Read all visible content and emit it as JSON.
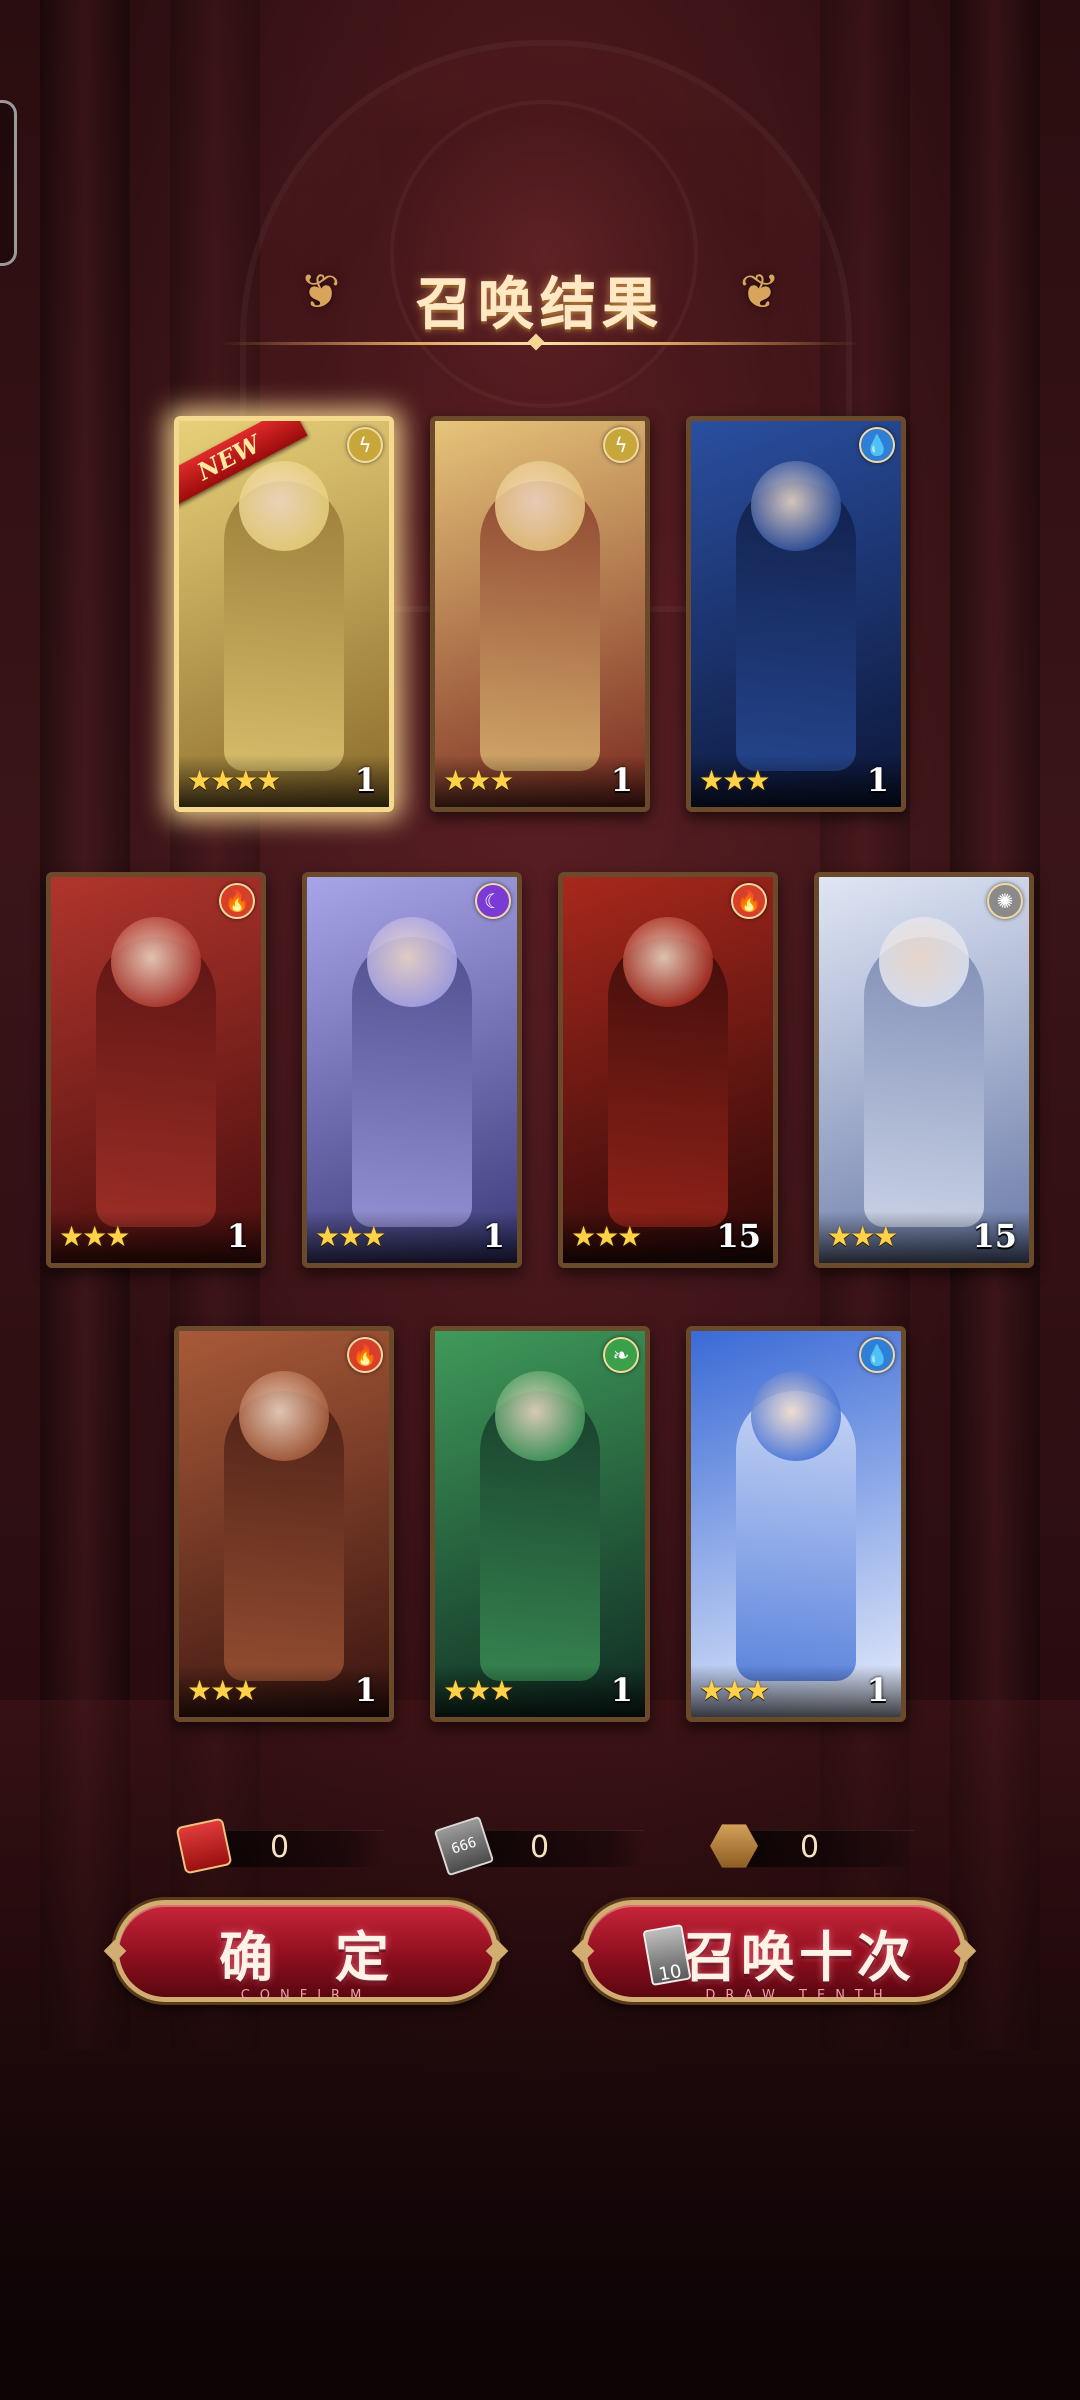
{
  "title": "召唤结果",
  "cards": [
    {
      "stars": "★★★★",
      "count": "1",
      "element_icon": "lightning-icon",
      "element_glyph": "ϟ",
      "element_color": "#c8a73a",
      "new_badge": "NEW",
      "theme": [
        "#e8d07a",
        "#8a6a2a"
      ]
    },
    {
      "stars": "★★★",
      "count": "1",
      "element_icon": "lightning-icon",
      "element_glyph": "ϟ",
      "element_color": "#c8a73a",
      "new_badge": "",
      "theme": [
        "#e6c47a",
        "#7a2a20"
      ]
    },
    {
      "stars": "★★★",
      "count": "1",
      "element_icon": "water-icon",
      "element_glyph": "💧",
      "element_color": "#2f7fd6",
      "new_badge": "",
      "theme": [
        "#2a4fa0",
        "#0c1638"
      ]
    },
    {
      "stars": "★★★",
      "count": "1",
      "element_icon": "fire-icon",
      "element_glyph": "🔥",
      "element_color": "#d6402a",
      "new_badge": "",
      "theme": [
        "#b0352c",
        "#4a0e0e"
      ]
    },
    {
      "stars": "★★★",
      "count": "1",
      "element_icon": "moon-icon",
      "element_glyph": "☾",
      "element_color": "#7a3ad6",
      "new_badge": "",
      "theme": [
        "#a8a4e8",
        "#3a3a7a"
      ]
    },
    {
      "stars": "★★★",
      "count": "15",
      "element_icon": "fire-icon",
      "element_glyph": "🔥",
      "element_color": "#d6402a",
      "new_badge": "",
      "theme": [
        "#a8281c",
        "#2a0808"
      ]
    },
    {
      "stars": "★★★",
      "count": "15",
      "element_icon": "light-icon",
      "element_glyph": "✺",
      "element_color": "#8a8a8a",
      "new_badge": "",
      "theme": [
        "#dfe6f4",
        "#6a7aa8"
      ]
    },
    {
      "stars": "★★★",
      "count": "1",
      "element_icon": "fire-icon",
      "element_glyph": "🔥",
      "element_color": "#d6402a",
      "new_badge": "",
      "theme": [
        "#a85a38",
        "#3a1410"
      ]
    },
    {
      "stars": "★★★",
      "count": "1",
      "element_icon": "leaf-icon",
      "element_glyph": "❧",
      "element_color": "#3aa04a",
      "new_badge": "",
      "theme": [
        "#3f9a5a",
        "#0f2a22"
      ]
    },
    {
      "stars": "★★★",
      "count": "1",
      "element_icon": "water-icon",
      "element_glyph": "💧",
      "element_color": "#2f7fd6",
      "new_badge": "",
      "theme": [
        "#3a6ad6",
        "#e8eefc"
      ]
    }
  ],
  "resources": [
    {
      "icon": "scroll-icon",
      "value": "0"
    },
    {
      "icon": "ticket-icon",
      "value": "0",
      "ticket_text": "666"
    },
    {
      "icon": "hexagon-token-icon",
      "value": "0"
    }
  ],
  "buttons": {
    "confirm": {
      "label": "确　定",
      "sub": "CONFIRM"
    },
    "draw_ten": {
      "label": "召唤十次",
      "sub": "DRAW TENTH",
      "ticket_count": "10"
    }
  }
}
